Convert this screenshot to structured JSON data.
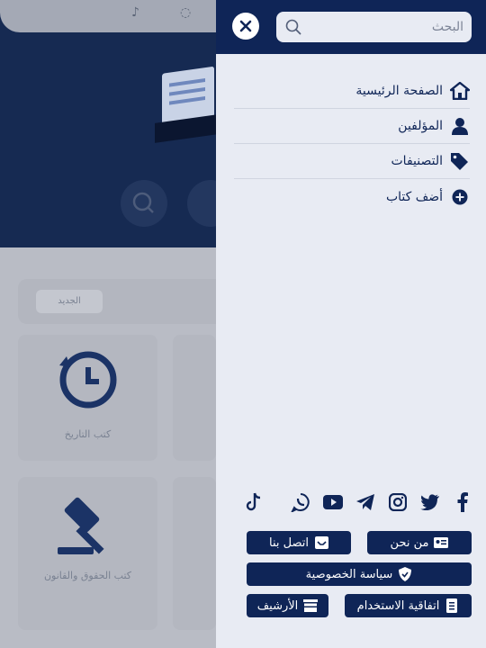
{
  "drawer": {
    "search": {
      "placeholder": "البحث"
    },
    "nav": [
      {
        "label": "الصفحة الرئيسية",
        "icon": "home-icon"
      },
      {
        "label": "المؤلفين",
        "icon": "user-icon"
      },
      {
        "label": "التصنيفات",
        "icon": "tags-icon"
      },
      {
        "label": "أضف كتاب",
        "icon": "plus-circle-icon"
      }
    ],
    "social": [
      "facebook-icon",
      "twitter-icon",
      "instagram-icon",
      "telegram-icon",
      "youtube-icon",
      "whatsapp-icon",
      "tiktok-icon"
    ],
    "links": {
      "about": "من نحن",
      "contact": "اتصل بنا",
      "privacy": "سياسة الخصوصية",
      "terms": "اتفاقية الاستخدام",
      "archive": "الأرشيف"
    }
  },
  "background": {
    "chip": "الجديد",
    "card_recent": "كتب التاريخ",
    "card_law": "كتب الحقوق والقانون"
  },
  "colors": {
    "primary": "#0f2557",
    "drawer_bg": "#e8ebf3",
    "header_bg": "#162a52"
  }
}
